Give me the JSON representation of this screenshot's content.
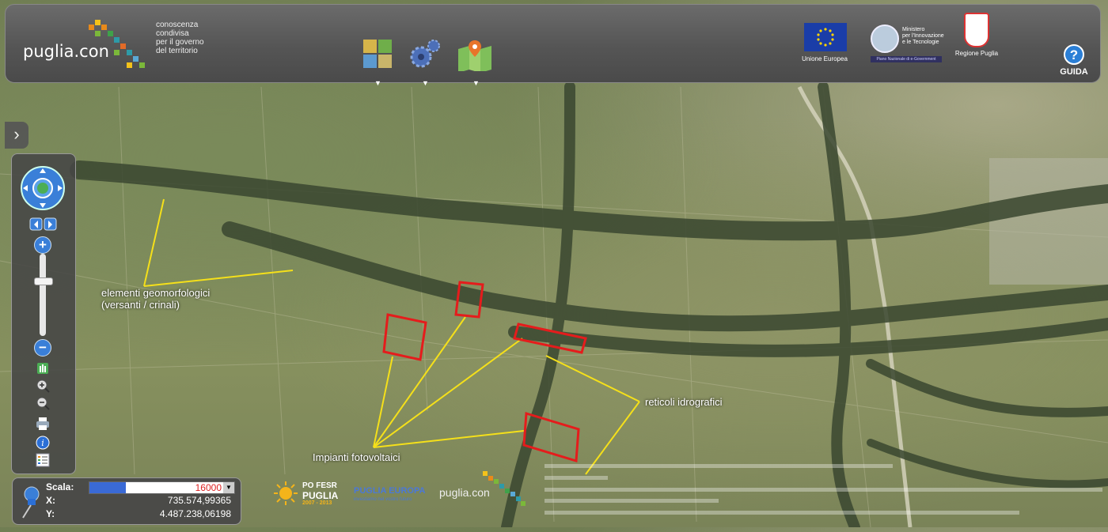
{
  "header": {
    "logo": "puglia.con",
    "tagline": [
      "conoscenza",
      "condivisa",
      "per il governo",
      "del territorio"
    ],
    "tools": [
      {
        "icon": "layers-grid-icon",
        "arrow": "▼"
      },
      {
        "icon": "gears-icon",
        "arrow": "▼"
      },
      {
        "icon": "map-pin-icon",
        "arrow": "▼"
      }
    ],
    "eu_label": "Unione Europea",
    "ministry_name": [
      "Ministero",
      "per l'Innovazione",
      "e le Tecnologie"
    ],
    "ministry_band": "Piano Nazionale di e-Government",
    "regione_label": "Regione Puglia",
    "guida_symbol": "?",
    "guida_label": "GUIDA"
  },
  "side_toggle": "›",
  "controls": {
    "zoom_in": "+",
    "zoom_out": "−"
  },
  "footer": {
    "scala_label": "Scala:",
    "scala_value": "16000",
    "x_label": "X:",
    "x_value": "735.574,99365",
    "y_label": "Y:",
    "y_value": "4.487.238,06198"
  },
  "sponsors": {
    "po_fesr": "PO FESR",
    "puglia": "PUGLIA",
    "years": "2007 - 2013",
    "puglia_europa": "PUGLIA EUROPA",
    "puglia_europa_sub": "investiamo nel vostro futuro",
    "pugliacon": "puglia.con"
  },
  "annotations": {
    "geo_line1": "elementi geomorfologici",
    "geo_line2": "(versanti / crinali)",
    "impianti": "Impianti fotovoltaici",
    "reticoli": "reticoli idrografici"
  },
  "colors": {
    "header_bg": "#555555",
    "annotation_line": "#f5e01a",
    "box_outline": "#e51c1c",
    "accent_blue": "#2b7fd6"
  }
}
